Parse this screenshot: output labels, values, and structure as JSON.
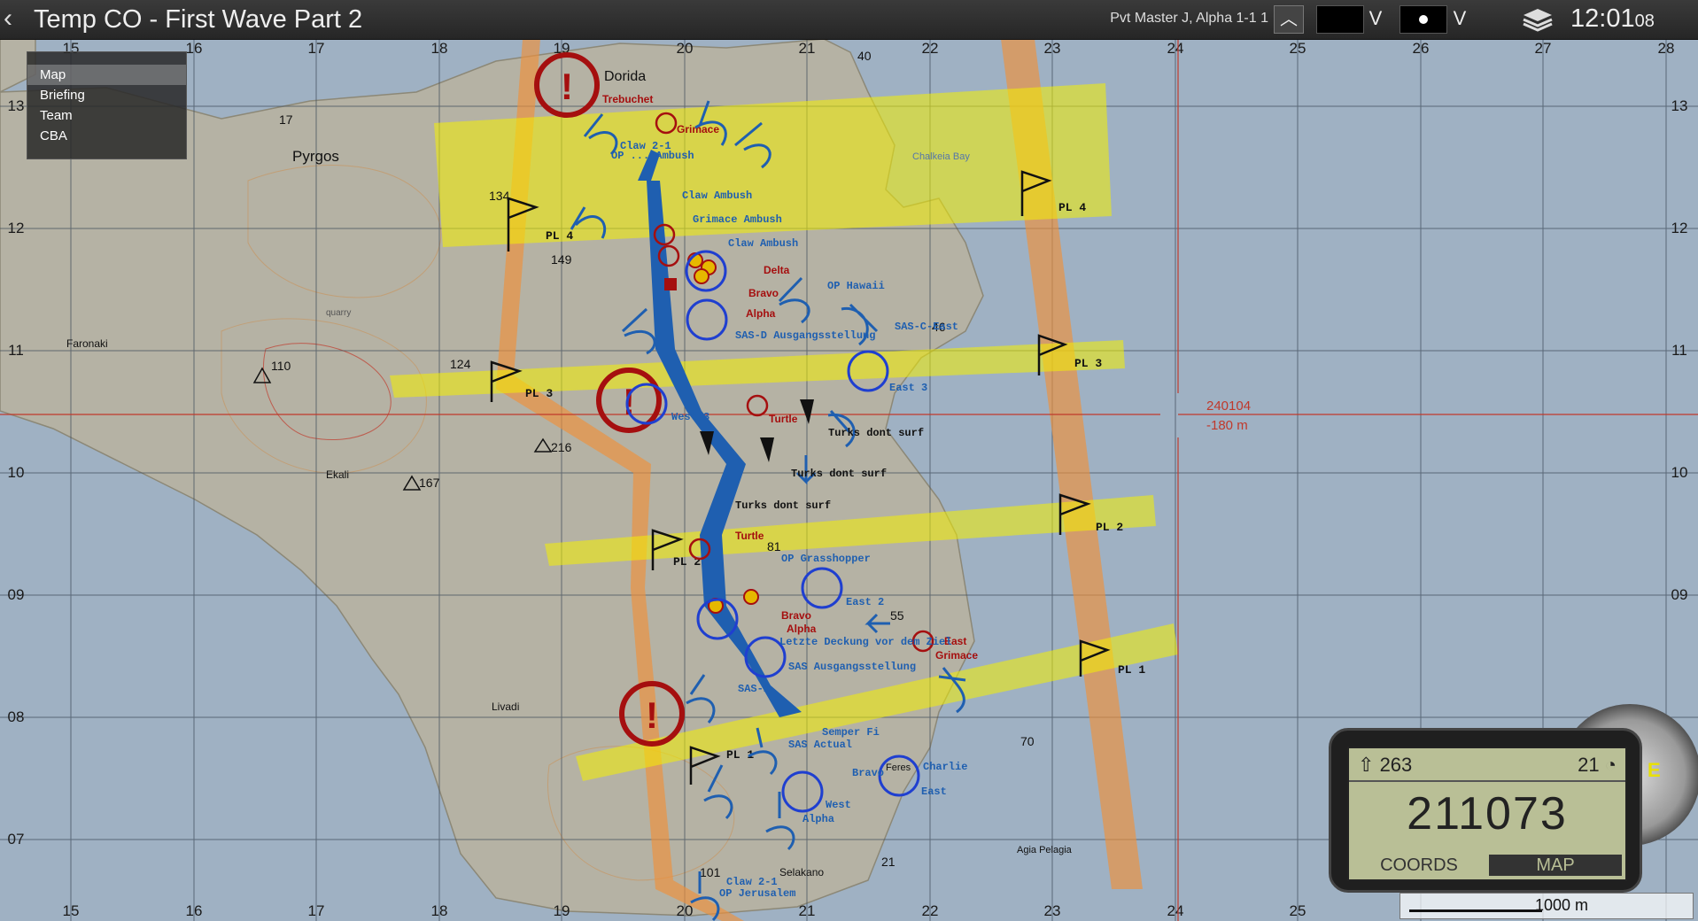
{
  "topbar": {
    "title": "Temp CO - First Wave Part 2",
    "player": "Pvt Master J, Alpha 1-1 1",
    "clock_hm": "12:01",
    "clock_s": "08",
    "back_icon": "chevron-left-icon",
    "layers_icon": "layers-icon"
  },
  "menu": {
    "items": [
      "Map",
      "Briefing",
      "Team",
      "CBA"
    ],
    "active": "Map"
  },
  "grid": {
    "x_labels": [
      "15",
      "16",
      "17",
      "18",
      "19",
      "20",
      "21",
      "22",
      "23",
      "24",
      "25",
      "26",
      "27",
      "28"
    ],
    "y_labels": [
      "13",
      "12",
      "11",
      "10",
      "09",
      "08",
      "07"
    ]
  },
  "cursor": {
    "grid": "240104",
    "elevation": "-180 m"
  },
  "places": [
    "Dorida",
    "Pyrgos",
    "Faronaki",
    "Ekali",
    "Livadi",
    "Selakano",
    "Feres",
    "Agia Pelagia",
    "Chalkeia Bay",
    "quarry"
  ],
  "heights": [
    "17",
    "40",
    "134",
    "149",
    "46",
    "124",
    "110",
    "216",
    "167",
    "81",
    "55",
    "70",
    "101",
    "21"
  ],
  "phase_lines": [
    "PL 4",
    "PL 4",
    "PL 3",
    "PL 3",
    "PL 2",
    "PL 2",
    "PL 1",
    "PL 1"
  ],
  "markers": {
    "red": [
      "Trebuchet",
      "Grimace",
      "Delta",
      "Bravo",
      "Alpha",
      "Turtle",
      "Turtle",
      "Bravo",
      "Alpha",
      "East",
      "Grimace"
    ],
    "blue": [
      "Claw 2-1",
      "OP ... Ambush",
      "Claw Ambush",
      "Grimace Ambush",
      "Claw Ambush",
      "OP Hawaii",
      "SAS-C-East",
      "SAS-D Ausgangsstellung",
      "East 3",
      "West 3",
      "Turks dont surf",
      "Turks dont surf",
      "Turks dont surf",
      "OP Grasshopper",
      "East 2",
      "Letzte Deckung vor dem Ziel",
      "SAS Ausgangsstellung",
      "SAS-P",
      "Semper Fi",
      "SAS Actual",
      "Bravo",
      "Charlie",
      "East",
      "West",
      "Alpha",
      "Claw 2-1",
      "OP Jerusalem"
    ]
  },
  "gps": {
    "heading": "263",
    "speed": "21",
    "grid": "211073",
    "coords_label": "COORDS",
    "map_label": "MAP"
  },
  "compass": {
    "dir": "E"
  },
  "scale": {
    "label": "1000 m",
    "ticks": [
      "26",
      "27",
      "28"
    ]
  },
  "colors": {
    "topbar": "#2f2f2f",
    "phase_line": "#f4f000",
    "boundary": "#f0903a",
    "enemy": "#a50f0f",
    "friendly": "#1f5fb0"
  }
}
